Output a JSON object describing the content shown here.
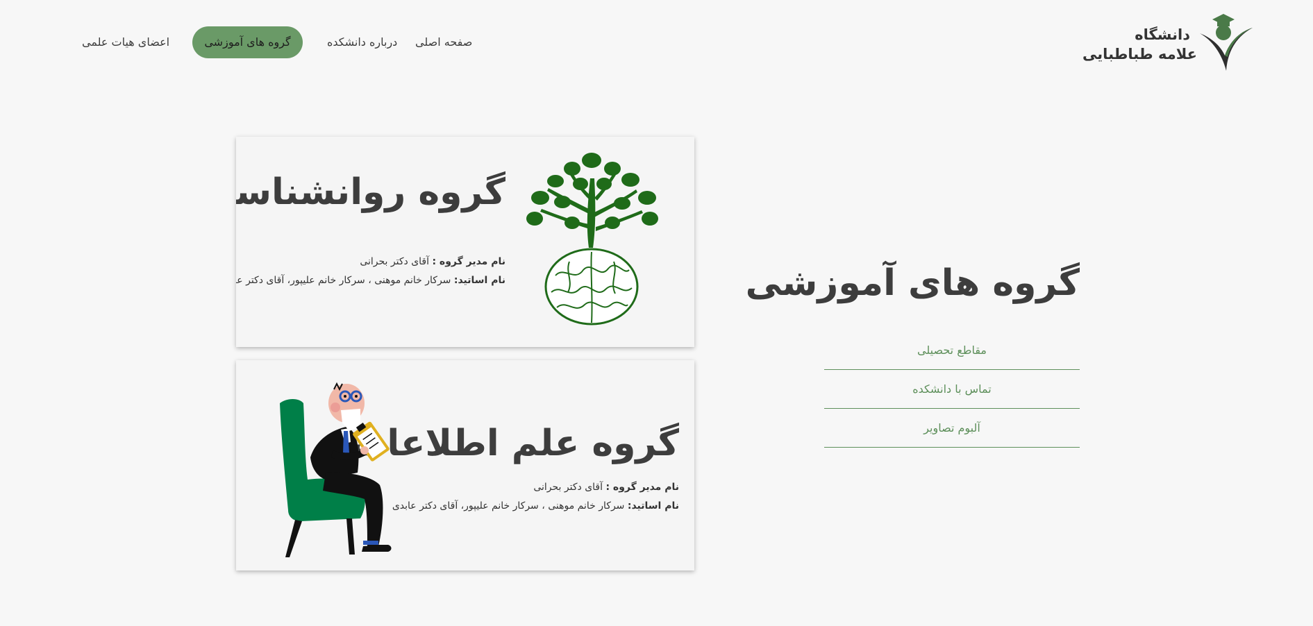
{
  "logo": {
    "line1": "دانشگاه",
    "line2": "علامه طباطبایی",
    "icon": "graduate-figure-icon",
    "color": "#4a7a48"
  },
  "nav": {
    "items": [
      {
        "label": "صفحه اصلی",
        "active": false
      },
      {
        "label": "درباره دانشکده",
        "active": false
      },
      {
        "label": "گروه های آموزشی",
        "active": true
      },
      {
        "label": "اعضای هیات علمی",
        "active": false
      }
    ],
    "active_color": "#6a9a67"
  },
  "cards": [
    {
      "title": "گروه روانشناسی",
      "manager_label": "نام مدیر گروه :",
      "manager_value": "آقای دکتر بحرانی",
      "professors_label": "نام اساتید:",
      "professors_value": "سرکار خانم موهنی ، سرکار خانم علیپور، آقای دکتر عابدی",
      "image": "tree-brain-icon"
    },
    {
      "title": "گروه علم اطلاعات",
      "manager_label": "نام مدیر گروه :",
      "manager_value": "آقای دکتر بحرانی",
      "professors_label": "نام اساتید:",
      "professors_value": "سرکار خانم موهنی ، سرکار خانم علیپور، آقای دکتر عابدی",
      "image": "psychologist-chair-icon"
    }
  ],
  "sidebar": {
    "title": "گروه های آموزشی",
    "links": [
      "مقاطع تحصیلی",
      "تماس با دانشکده",
      "آلبوم تصاویر"
    ],
    "link_color": "#5d8f5a"
  }
}
